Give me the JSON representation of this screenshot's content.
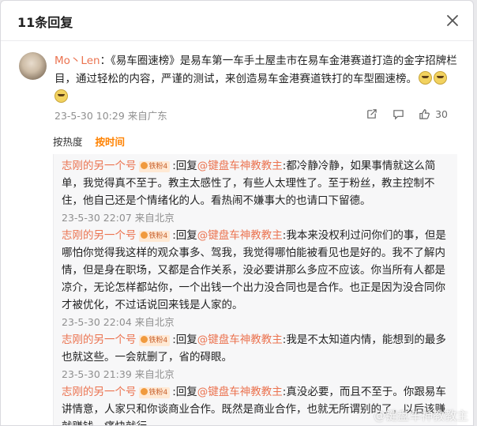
{
  "header": {
    "title": "11条回复"
  },
  "root_comment": {
    "user": "Mo丶Len",
    "text": "：《易车圈速榜》是易车第一车手土屋圭市在易车金港赛道打造的金字招牌栏目，通过轻松的内容，严谨的测试，来创造易车金港赛道铁打的车型圈速榜。",
    "time": "23-5-30 10:29 来自广东",
    "like_count": "30"
  },
  "sort": {
    "hot": "按热度",
    "time": "按时间"
  },
  "replies": [
    {
      "nick": "志刚的另一个号",
      "fan_badge": "铁粉4",
      "prefix": ":回复",
      "mention": "@键盘车神教教主",
      "text": ":都冷静冷静，如果事情就这么简单，我觉得真不至于。教主太感性了，有些人太理性了。至于粉丝，教主控制不住，他自己还是个情绪化的人。看热闹不嫌事大的也请口下留德。",
      "time": "23-5-30 22:07 来自北京"
    },
    {
      "nick": "志刚的另一个号",
      "fan_badge": "铁粉4",
      "prefix": ":回复",
      "mention": "@键盘车神教教主",
      "text": ":我本来没权利过问你们的事，但是哪怕你觉得我这样的观众事多、驾我，我觉得哪怕能被看见也是好的。我不了解内情，但是身在职场，又都是合作关系，没必要讲那么多应不应该。你当所有人都是凉介，无论怎样都站你，一个出钱一个出力没合同也是合作。也正是因为没合同你才被优化，不过话说回来钱是人家的。",
      "time": "23-5-30 22:04 来自北京"
    },
    {
      "nick": "志刚的另一个号",
      "fan_badge": "铁粉4",
      "prefix": ":回复",
      "mention": "@键盘车神教教主",
      "text": ":我是不太知道内情，能想到的最多也就这些。一会就删了，省的碍眼。",
      "time": "23-5-30 21:39 来自北京"
    },
    {
      "nick": "志刚的另一个号",
      "fan_badge": "铁粉4",
      "prefix": ":回复",
      "mention": "@键盘车神教教主",
      "text": ":真没必要，而且不至于。你跟易车讲情意，人家只和你谈商业合作。既然是商业合作，也就无所谓别的了，以后该赚就赚钱，痛快就行。",
      "time": ""
    }
  ],
  "watermark": "@键盘车神教教主",
  "colors": {
    "accent": "#ff8200",
    "link": "#eb7350",
    "muted": "#8f8f8f"
  }
}
